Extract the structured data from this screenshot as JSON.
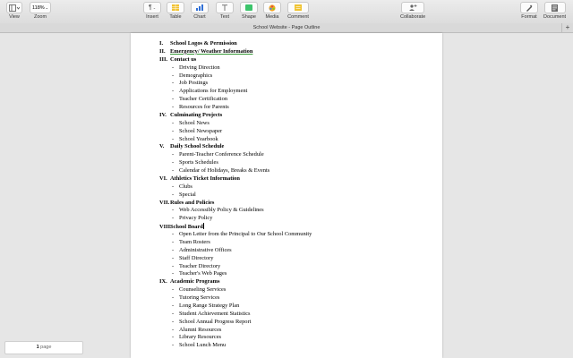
{
  "toolbar": {
    "view_label": "View",
    "zoom_value": "118%",
    "zoom_label": "Zoom",
    "insert_label": "Insert",
    "insert_glyph": "¶",
    "table_label": "Table",
    "chart_label": "Chart",
    "text_label": "Text",
    "shape_label": "Shape",
    "media_label": "Media",
    "comment_label": "Comment",
    "collaborate_label": "Collaborate",
    "format_label": "Format",
    "document_label": "Document"
  },
  "window": {
    "title": "School Website - Page Outline",
    "add_glyph": "+"
  },
  "document": {
    "lines": [
      {
        "type": "head",
        "num": "I.",
        "text": "School Logos & Permission"
      },
      {
        "type": "head",
        "num": "II.",
        "text": "Emergency/ Weather Information"
      },
      {
        "type": "head",
        "num": "III.",
        "text": "Contact us"
      },
      {
        "type": "sub",
        "text": "Driving Direction"
      },
      {
        "type": "sub",
        "text": "Demographics"
      },
      {
        "type": "sub",
        "text": "Job Postings"
      },
      {
        "type": "sub",
        "text": "Applications for Employment"
      },
      {
        "type": "sub",
        "text": "Teacher Certification"
      },
      {
        "type": "sub",
        "text": "Resources for Parents"
      },
      {
        "type": "head",
        "num": "IV.",
        "text": "Culminating Projects"
      },
      {
        "type": "sub",
        "text": "School News"
      },
      {
        "type": "sub",
        "text": "School Newspaper"
      },
      {
        "type": "sub",
        "text": "School Yearbook"
      },
      {
        "type": "head",
        "num": "V.",
        "text": "Daily School Schedule"
      },
      {
        "type": "sub",
        "text": "Parent-Teacher Conference Schedule"
      },
      {
        "type": "sub",
        "text": "Sports Schedules"
      },
      {
        "type": "sub",
        "text": "Calendar of Holidays, Breaks & Events"
      },
      {
        "type": "head",
        "num": "VI.",
        "text": "Athletics Ticket Information"
      },
      {
        "type": "sub",
        "text": "Clubs"
      },
      {
        "type": "sub",
        "text": "Special"
      },
      {
        "type": "head",
        "num": "VII.",
        "text": "Rules and Policies"
      },
      {
        "type": "sub",
        "text": "Web Accessibly Policy & Guidelines"
      },
      {
        "type": "sub",
        "text": "Privacy Policy"
      },
      {
        "type": "head",
        "num": "VIII.",
        "text": "School Board"
      },
      {
        "type": "sub",
        "text": "Open Letter from the Principal to Our School Community"
      },
      {
        "type": "sub",
        "text": "Team Rosters"
      },
      {
        "type": "sub",
        "text": "Administrative Offices"
      },
      {
        "type": "sub",
        "text": "Staff Directory"
      },
      {
        "type": "sub",
        "text": "Teacher Directory"
      },
      {
        "type": "sub",
        "text": "Teacher's Web Pages"
      },
      {
        "type": "head",
        "num": "IX.",
        "text": "Academic Programs"
      },
      {
        "type": "sub",
        "text": "Counseling Services"
      },
      {
        "type": "sub",
        "text": "Tutoring Services"
      },
      {
        "type": "sub",
        "text": "Long Range Strategy Plan"
      },
      {
        "type": "sub",
        "text": "Student Achievement Statistics"
      },
      {
        "type": "sub",
        "text": "School Annual Progress Report"
      },
      {
        "type": "sub",
        "text": "Alumni Resources"
      },
      {
        "type": "sub",
        "text": "Library Resources"
      },
      {
        "type": "sub",
        "text": "School Lunch Menu"
      }
    ]
  },
  "status": {
    "page_count": "1",
    "page_word": "page"
  },
  "colors": {
    "chart_blue": "#2f6fd6",
    "table_yellow": "#f2c230",
    "shape_green": "#3cc46b",
    "comment_yellow": "#f0c330",
    "spell_green": "#3a9a3a"
  },
  "icons": [
    "view-icon",
    "insert-icon",
    "table-icon",
    "chart-icon",
    "text-icon",
    "shape-icon",
    "media-icon",
    "comment-icon",
    "collaborate-icon",
    "format-icon",
    "document-icon"
  ]
}
